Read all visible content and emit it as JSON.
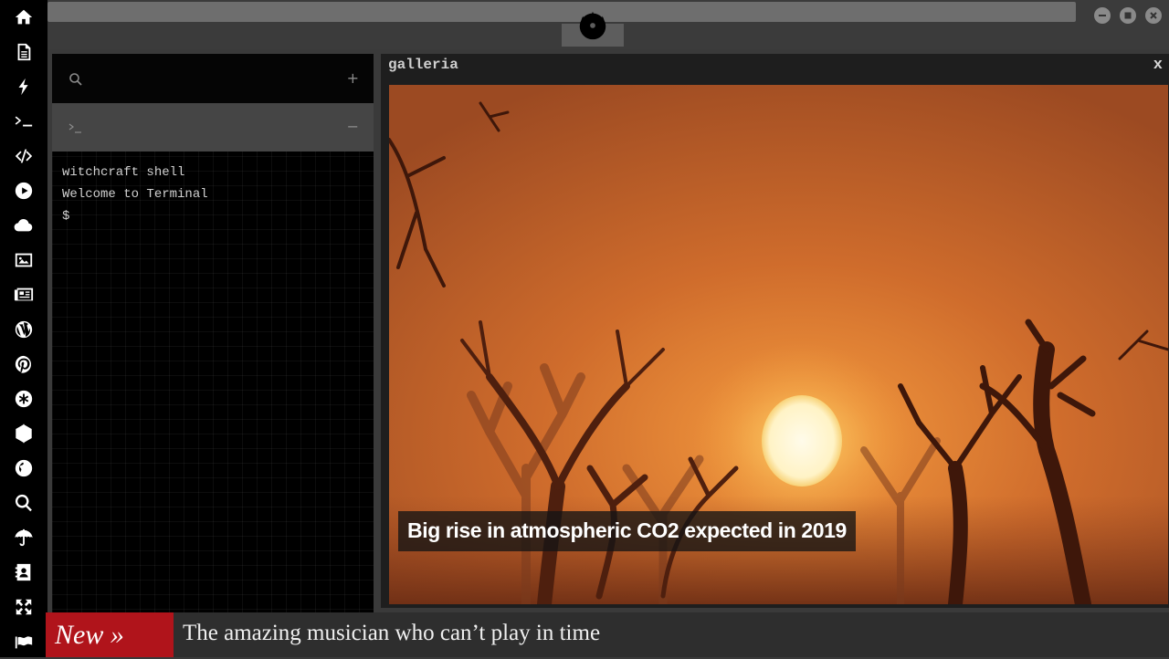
{
  "dock": {
    "items": [
      {
        "name": "home-icon"
      },
      {
        "name": "document-icon"
      },
      {
        "name": "bolt-icon"
      },
      {
        "name": "terminal-icon"
      },
      {
        "name": "code-icon"
      },
      {
        "name": "play-icon"
      },
      {
        "name": "cloud-icon"
      },
      {
        "name": "image-icon"
      },
      {
        "name": "newspaper-icon"
      },
      {
        "name": "wordpress-icon"
      },
      {
        "name": "pinterest-icon"
      },
      {
        "name": "asterisk-icon"
      },
      {
        "name": "sphere-icon"
      },
      {
        "name": "globe-icon"
      },
      {
        "name": "search-icon"
      },
      {
        "name": "umbrella-icon"
      },
      {
        "name": "contacts-icon"
      },
      {
        "name": "fullscreen-icon"
      },
      {
        "name": "flag-icon"
      }
    ]
  },
  "window_controls": [
    "minimize-icon",
    "maximize-icon",
    "close-icon"
  ],
  "terminal": {
    "add_label": "+",
    "tab_collapse_label": "−",
    "lines": [
      "witchcraft shell",
      "Welcome to Terminal",
      "$"
    ]
  },
  "gallery": {
    "title": "galleria",
    "close_label": "x",
    "caption": "Big rise in atmospheric CO2 expected in 2019"
  },
  "ticker": {
    "badge": "New »",
    "headline": "The amazing musician who can’t play in time"
  },
  "colors": {
    "dock_bg": "#000000",
    "workspace_bg": "#3a3a3a",
    "ticker_badge": "#b0141b",
    "sunset_orange": "#c86a2c"
  }
}
